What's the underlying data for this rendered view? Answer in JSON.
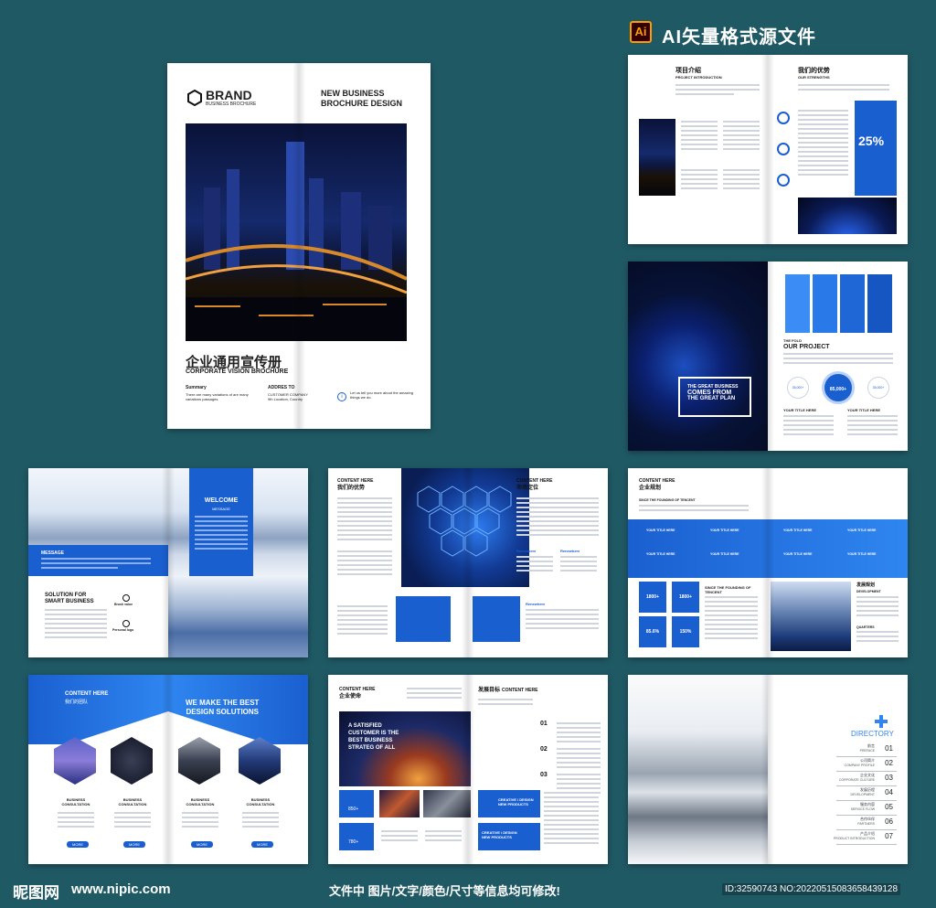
{
  "header": {
    "ai_badge": "Ai",
    "title": "AI矢量格式源文件"
  },
  "cover": {
    "brand": "BRAND",
    "brand_sub": "BUSINESS BROCHURE",
    "headline": "NEW BUSINESS\nBROCHURE DESIGN",
    "title_cn": "企业通用宣传册",
    "title_en": "CORPORATE VISION BROCHURE",
    "summary_label": "Summary",
    "summary_text": "There are many variations of are many variations passages.",
    "address_label": "ADDRES TO",
    "address_text": "CUSTOMER COMPANY\n9th Location, Country",
    "tell_text": "Let us tell you more about the amazing things we do."
  },
  "page_intro": {
    "title_cn": "项目介绍",
    "title_en": "PROJECT INTRODUCTION",
    "strengths_cn": "我们的优势",
    "strengths_en": "OUR STRENGTHS",
    "percent": "25%"
  },
  "page_project": {
    "great_1": "THE GREAT BUSINESS",
    "great_2": "COMES FROM",
    "great_3": "THE GREAT PLAN",
    "the_fold": "THE FOLD",
    "our_project": "OUR PROJECT",
    "big_number": "85,000+",
    "small_number_1": "35,000+",
    "small_number_2": "35,000+",
    "your_title": "YOUR TITLE HERE"
  },
  "page_welcome": {
    "welcome": "WELCOME",
    "message_small": "MESSAGE",
    "message": "MESSAGE",
    "solution": "SOLUTION FOR\nSMART BUSINESS",
    "item1": "Brush value",
    "item2": "Personal logo"
  },
  "page_security": {
    "content_here": "CONTENT HERE",
    "cn_left": "我们的优势",
    "cn_right": "市场定位",
    "label": "Renewhere"
  },
  "page_planning": {
    "content_here": "CONTENT HERE",
    "cn": "企业规划",
    "founding": "SINCE THE FOUNDING OF TENCENT",
    "project_name": "PROJECT NAME",
    "stats": [
      "1800+",
      "1800+",
      "85.6%",
      "150%"
    ],
    "your_title": "YOUR TITLE HERE",
    "development_cn": "发展规划",
    "development_en": "DEVELOPMENT",
    "quarters": "QUARTERS"
  },
  "page_team": {
    "content_here": "CONTENT HERE",
    "cn": "我们的团队",
    "best": "WE MAKE THE BEST\nDESIGN SOLUTIONS",
    "consult": "BUSINESS\nCONSULTATION",
    "more": "MORE"
  },
  "page_mission": {
    "content_here": "CONTENT HERE",
    "cn": "企业使命",
    "cn_right": "发展目标",
    "satisfied": "A SATISFIED\nCUSTOMER IS THE\nBEST BUSINESS\nSTRATEG OF ALL",
    "numbers": [
      "01",
      "02",
      "03"
    ],
    "stat_1": "850+",
    "stat_2": "780+",
    "creative": "CREATIVE / DESIGN\nNEW PRODUCTS"
  },
  "page_directory": {
    "directory": "DIRECTORY",
    "entries": [
      {
        "cn": "前言",
        "en": "PREFACE",
        "no": "01"
      },
      {
        "cn": "公司简介",
        "en": "COMPANY PROFILE",
        "no": "02"
      },
      {
        "cn": "企业文化",
        "en": "CORPORATE CULTURE",
        "no": "03"
      },
      {
        "cn": "发展历程",
        "en": "DEVELOPMENT",
        "no": "04"
      },
      {
        "cn": "服务内容",
        "en": "SERVICE FLOW",
        "no": "05"
      },
      {
        "cn": "合作伙伴",
        "en": "PARTNERS",
        "no": "06"
      },
      {
        "cn": "产品介绍",
        "en": "PRODUCT INTRODUCTION",
        "no": "07"
      }
    ]
  },
  "footer": {
    "logo_cn": "昵图网",
    "site": "www.nipic.com",
    "note": "文件中 图片/文字/颜色/尺寸等信息均可修改!",
    "id_text": "ID:32590743 NO:20220515083658439128"
  },
  "colors": {
    "background": "#1f5964",
    "accent": "#1a5fd0",
    "dark_navy": "#0b1c4a"
  }
}
